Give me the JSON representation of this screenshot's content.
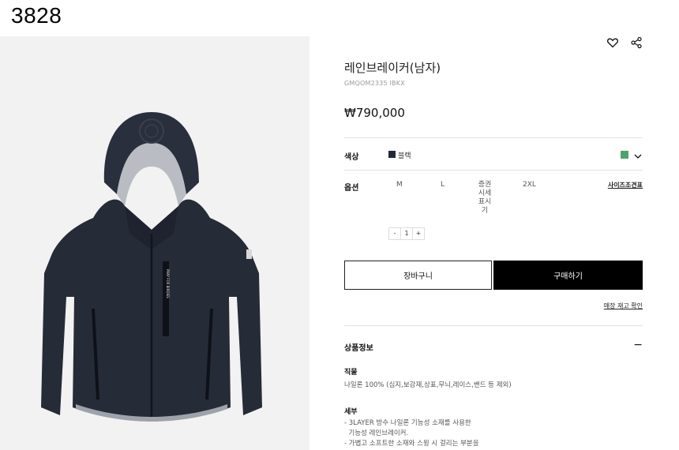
{
  "corner_id": "3828",
  "product": {
    "title": "레인브레이커(남자)",
    "code": "GMQOM2335 IBKX",
    "price": "₩790,000"
  },
  "icons": {
    "wishlist": "heart-icon",
    "share": "share-icon"
  },
  "color": {
    "label": "색상",
    "selected_name": "블랙",
    "swatch_color": "#23283a",
    "alt_color": "#4fa36a"
  },
  "options": {
    "label": "옵션",
    "sizes": [
      "M",
      "L",
      "증권시세표시기",
      "2XL"
    ],
    "size_guide": "사이즈조견표"
  },
  "quantity": {
    "minus": "-",
    "value": "1",
    "plus": "+"
  },
  "buttons": {
    "cart": "장바구니",
    "buy": "구매하기"
  },
  "stock_link": "매장 재고 확인",
  "info": {
    "title": "상품정보",
    "toggle": "−",
    "fabric_title": "직물",
    "fabric_text": "나일론 100% (심지,보강재,상표,무늬,레이스,밴드 등 제외)",
    "detail_title": "세부",
    "detail_lines": [
      "- 3LAYER 방수 나일론 기능성 소재를 사용한",
      "  기능성 레인브레이커.",
      "- 가볍고 소프트한 소재와 스윙 시 걸리는 부분을"
    ]
  },
  "jacket_print": "PRAY FOR BIRDIES"
}
